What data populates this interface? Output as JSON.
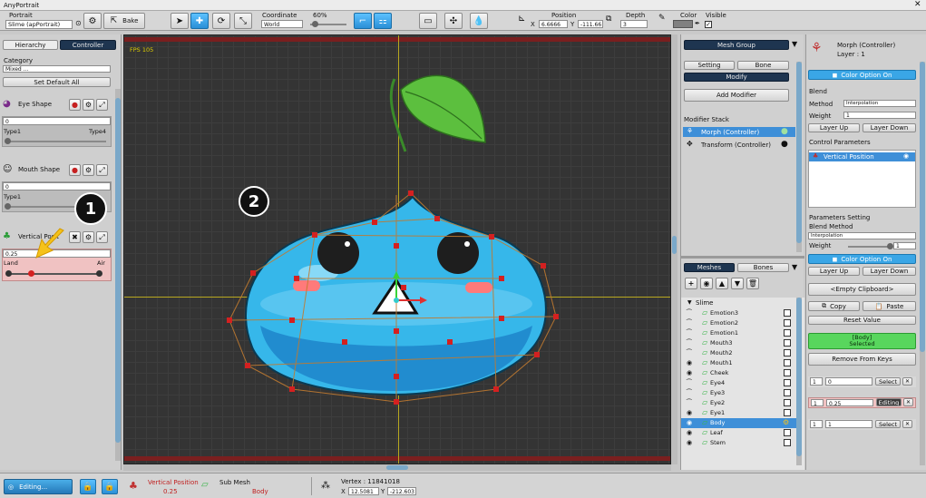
{
  "app_title": "AnyPortrait",
  "toolbar": {
    "portrait_label": "Portrait",
    "portrait_value": "Slime (apPortrait)",
    "bake_label": "Bake",
    "coordinate_label": "Coordinate",
    "coordinate_value": "World",
    "zoom_label": "60%",
    "position_label": "Position",
    "pos_x_label": "X",
    "pos_x": "6.6666",
    "pos_y_label": "Y",
    "pos_y": "-111.66",
    "depth_label": "Depth",
    "depth_value": "3",
    "color_label": "Color",
    "visible_label": "Visible"
  },
  "left_panel": {
    "tab_hierarchy": "Hierarchy",
    "tab_controller": "Controller",
    "category_label": "Category",
    "category_value": "Mixed ...",
    "set_default_all": "Set Default All",
    "eye_shape": {
      "name": "Eye Shape",
      "value": "0",
      "min_label": "Type1",
      "max_label": "Type4"
    },
    "mouth_shape": {
      "name": "Mouth Shape",
      "value": "0",
      "min_label": "Type1"
    },
    "vertical_position": {
      "name": "Vertical Posit",
      "value": "0.25",
      "min_label": "Land",
      "max_label": "Air",
      "level": 0.25
    }
  },
  "viewport": {
    "fps": "FPS 105",
    "badge1": "1",
    "badge2": "2"
  },
  "mid_panel": {
    "header": "Mesh Group",
    "setting": "Setting",
    "bone": "Bone",
    "modify": "Modify",
    "add_modifier": "Add Modifier",
    "modifier_stack_label": "Modifier Stack",
    "modifiers": [
      "Morph (Controller)",
      "Transform (Controller)"
    ],
    "tab_meshes": "Meshes",
    "tab_bones": "Bones",
    "root": "Slime",
    "meshes": [
      "Emotion3",
      "Emotion2",
      "Emotion1",
      "Mouth3",
      "Mouth2",
      "Mouth1",
      "Cheek",
      "Eye4",
      "Eye3",
      "Eye2",
      "Eye1",
      "Body",
      "Leaf",
      "Stem"
    ],
    "selected_mesh": "Body"
  },
  "right_panel": {
    "title": "Morph (Controller)",
    "layer": "Layer : 1",
    "color_option": "Color Option On",
    "blend_label": "Blend",
    "method_label": "Method",
    "method_value": "Interpolation",
    "weight_label": "Weight",
    "weight_value": "1",
    "layer_up": "Layer Up",
    "layer_down": "Layer Down",
    "control_params_label": "Control Parameters",
    "control_param_item": "Vertical Position",
    "params_setting_label": "Parameters Setting",
    "blend_method_label": "Blend Method",
    "blend_method_value": "Interpolation",
    "weight2_label": "Weight",
    "weight2_value": "1",
    "color_option2": "Color Option On",
    "layer_up2": "Layer Up",
    "layer_down2": "Layer Down",
    "empty_clipboard": "<Empty Clipboard>",
    "copy": "Copy",
    "paste": "Paste",
    "reset_value": "Reset Value",
    "body_label": "[Body]",
    "selected_label": "Selected",
    "remove_from_keys": "Remove From Keys",
    "keys": [
      {
        "num": "1",
        "value": "0",
        "action": "Select"
      },
      {
        "num": "1",
        "value": "0.25",
        "action": "Editing"
      },
      {
        "num": "1",
        "value": "1",
        "action": "Select"
      }
    ]
  },
  "statusbar": {
    "editing": "Editing...",
    "vertical_position_label": "Vertical Position",
    "vertical_position_value": "0.25",
    "sub_mesh_label": "Sub Mesh",
    "sub_mesh_value": "Body",
    "vertex_label": "Vertex : 11841018",
    "x_label": "X",
    "x_value": "12.5081",
    "y_label": "Y",
    "y_value": "-212.603"
  },
  "colors": {
    "accent": "#3aa6e6",
    "dark_header": "#1e3550",
    "selected": "#3e8fd8",
    "editing_row": "#f4c8c8",
    "viewport_bg": "#333333",
    "green_selected": "#58d65d"
  }
}
